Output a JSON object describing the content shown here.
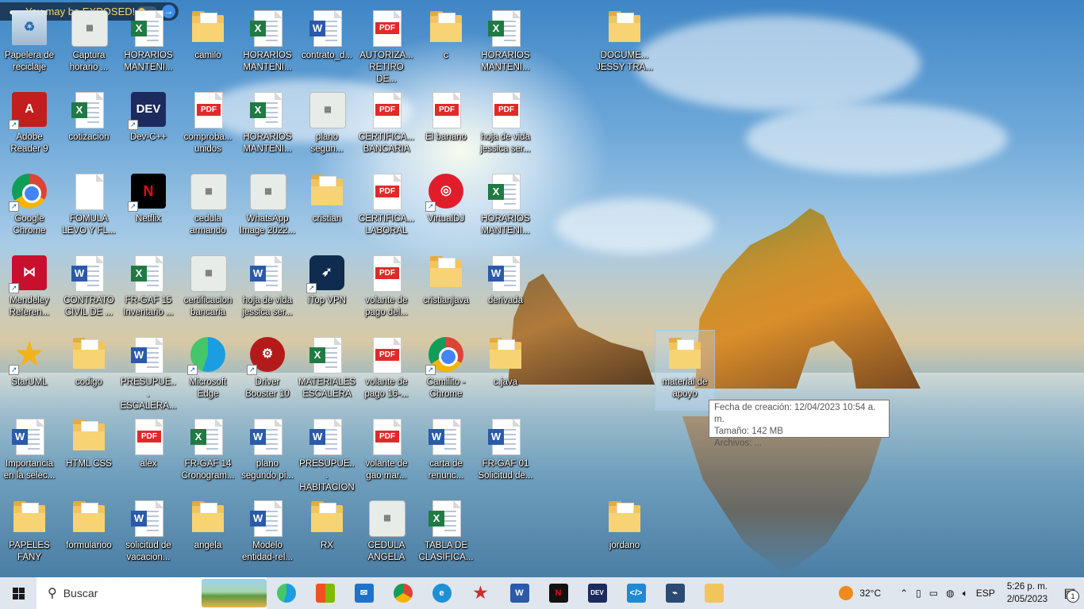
{
  "banner": {
    "text": "You may be EXPOSED!"
  },
  "icons": [
    {
      "label": "Papelera de reciclaje",
      "type": "recycle"
    },
    {
      "label": "Captura horario ...",
      "type": "image"
    },
    {
      "label": "HORARIOS MANTENI...",
      "type": "excel"
    },
    {
      "label": "camilo",
      "type": "folder"
    },
    {
      "label": "HORARIOS MANTENI...",
      "type": "excel"
    },
    {
      "label": "contrato_d...",
      "type": "word"
    },
    {
      "label": "AUTORIZA... RETIRO DE...",
      "type": "pdf"
    },
    {
      "label": "c",
      "type": "folder"
    },
    {
      "label": "HORARIOS MANTENI...",
      "type": "excel"
    },
    {
      "label": "DOCUME... JESSY TRA...",
      "type": "folder"
    },
    {
      "label": "Adobe Reader 9",
      "type": "adobe"
    },
    {
      "label": "cotizacion",
      "type": "excel"
    },
    {
      "label": "Dev-C++",
      "type": "devcpp"
    },
    {
      "label": "comproba... unidos",
      "type": "pdf"
    },
    {
      "label": "HORARIOS MANTENI...",
      "type": "excel"
    },
    {
      "label": "plano segun...",
      "type": "image"
    },
    {
      "label": "CERTIFICA... BANCARIA",
      "type": "pdf"
    },
    {
      "label": "El banano",
      "type": "pdf"
    },
    {
      "label": "hoja de vida jessica ser...",
      "type": "pdf"
    },
    {
      "label": "Google Chrome",
      "type": "chrome"
    },
    {
      "label": "FOMULA LEVO Y FL...",
      "type": "blank"
    },
    {
      "label": "Netflix",
      "type": "netflix"
    },
    {
      "label": "cedula armando",
      "type": "image"
    },
    {
      "label": "WhatsApp Image 2022...",
      "type": "image"
    },
    {
      "label": "cristian",
      "type": "folder"
    },
    {
      "label": "CERTIFICA... LABORAL",
      "type": "pdf"
    },
    {
      "label": "VirtualDJ",
      "type": "virtualdj"
    },
    {
      "label": "HORARIOS MANTENI...",
      "type": "excel"
    },
    {
      "label": "Mendeley Referen...",
      "type": "mendeley"
    },
    {
      "label": "CONTRATO CIVIL DE ...",
      "type": "word"
    },
    {
      "label": "FR-GAF 15 Inventario ...",
      "type": "excel"
    },
    {
      "label": "certificacion bancaria",
      "type": "image"
    },
    {
      "label": "hoja de vida jessica ser...",
      "type": "word"
    },
    {
      "label": "iTop VPN",
      "type": "itop"
    },
    {
      "label": "volante de pago del...",
      "type": "pdf"
    },
    {
      "label": "cristianjava",
      "type": "folder"
    },
    {
      "label": "derivada",
      "type": "word"
    },
    {
      "label": "StarUML",
      "type": "staruml"
    },
    {
      "label": "codigo",
      "type": "folder"
    },
    {
      "label": "PRESUPUE... ESCALERA...",
      "type": "word"
    },
    {
      "label": "Microsoft Edge",
      "type": "edge"
    },
    {
      "label": "Driver Booster 10",
      "type": "driver"
    },
    {
      "label": "MATERIALES ESCALERA",
      "type": "excel"
    },
    {
      "label": "volante de pago 16-...",
      "type": "pdf"
    },
    {
      "label": "Camilito - Chrome",
      "type": "chrome"
    },
    {
      "label": "c.java",
      "type": "folder"
    },
    {
      "label": "material de apoyo",
      "type": "folder"
    },
    {
      "label": "Importancia en la selec...",
      "type": "word"
    },
    {
      "label": "HTML CSS",
      "type": "folder"
    },
    {
      "label": "alex",
      "type": "pdf"
    },
    {
      "label": "FR-GAF 14 Cronogram...",
      "type": "excel"
    },
    {
      "label": "plano segundo pi...",
      "type": "word"
    },
    {
      "label": "PRESUPUE... HABITACION",
      "type": "word"
    },
    {
      "label": "volante de gao mar...",
      "type": "pdf"
    },
    {
      "label": "carta de renunc...",
      "type": "word"
    },
    {
      "label": "FR-GAF 01 Solicitud de...",
      "type": "word"
    },
    {
      "label": "PAPELES FANY",
      "type": "folder"
    },
    {
      "label": "formularioo",
      "type": "folder"
    },
    {
      "label": "solicitud de vacacion...",
      "type": "word"
    },
    {
      "label": "angela",
      "type": "folder"
    },
    {
      "label": "Modelo entidad-rel...",
      "type": "word"
    },
    {
      "label": "RX",
      "type": "folder"
    },
    {
      "label": "CEDULA ANGELA",
      "type": "image"
    },
    {
      "label": "TABLA DE CLASIFICA...",
      "type": "excel"
    },
    {
      "label": "jordano",
      "type": "folder"
    }
  ],
  "tooltip": {
    "line1": "Fecha de creación: 12/04/2023 10:54 a. m.",
    "line2": "Tamaño: 142 MB",
    "line3": "Archivos: ..."
  },
  "taskbar": {
    "search_placeholder": "Buscar",
    "apps": [
      "edge-icon",
      "store-icon",
      "mail-icon",
      "chrome-icon",
      "ie-icon",
      "staruml-icon",
      "word-icon",
      "netflix-icon",
      "devcpp-icon",
      "vscode-icon",
      "terminal-icon",
      "explorer-icon"
    ],
    "weather": "32°C",
    "lang": "ESP",
    "time": "5:26 p. m.",
    "date": "2/05/2023",
    "notif_count": "1"
  },
  "colors": {
    "taskbar_bg": "#dfe6ee",
    "banner_bg": "#1e3d5c",
    "banner_text": "#f5d66b"
  }
}
